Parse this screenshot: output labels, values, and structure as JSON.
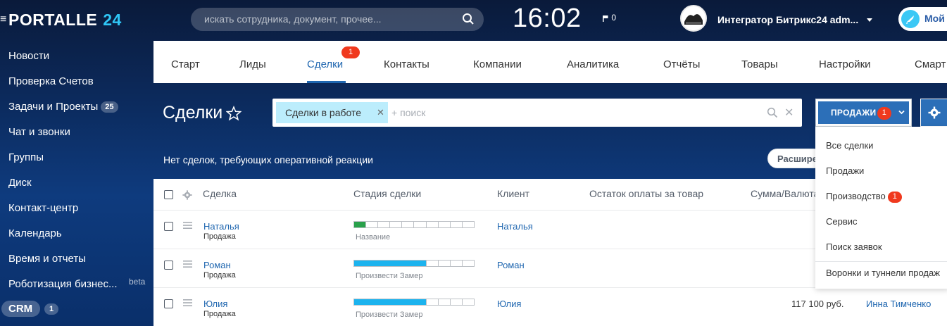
{
  "header": {
    "logo_text": "PORTALLE",
    "logo_number": "24",
    "search_placeholder": "искать сотрудника, документ, прочее...",
    "clock": "16:02",
    "flag_count": "0",
    "user_name": "Интегратор Битрикс24 adm...",
    "my_button_label": "Мой"
  },
  "sidebar": {
    "items": [
      {
        "label": "Новости"
      },
      {
        "label": "Проверка Счетов"
      },
      {
        "label": "Задачи и Проекты",
        "count": "25"
      },
      {
        "label": "Чат и звонки"
      },
      {
        "label": "Группы"
      },
      {
        "label": "Диск"
      },
      {
        "label": "Контакт-центр"
      },
      {
        "label": "Календарь"
      },
      {
        "label": "Время и отчеты"
      },
      {
        "label": "Роботизация бизнес..."
      }
    ],
    "beta_label": "beta",
    "crm_label": "CRM",
    "crm_count": "1"
  },
  "tabs": {
    "items": [
      "Старт",
      "Лиды",
      "Сделки",
      "Контакты",
      "Компании",
      "Аналитика",
      "Отчёты",
      "Товары",
      "Настройки",
      "Смарт"
    ],
    "active": "Сделки",
    "badge": "1"
  },
  "toolbar": {
    "title": "Сделки",
    "filter_chip": "Сделки в работе",
    "filter_placeholder": "+ поиск",
    "sales_button": "ПРОДАЖИ",
    "sales_badge": "1"
  },
  "notice": {
    "text": "Нет сделок, требующих оперативной реакции",
    "expand_button": "Расширенный"
  },
  "grid": {
    "columns": [
      "Сделка",
      "Стадия сделки",
      "Клиент",
      "Остаток оплаты за товар",
      "Сумма/Валюта"
    ],
    "rows": [
      {
        "name": "Наталья",
        "type": "Продажа",
        "stage": "Название",
        "stage_progress": 0.14,
        "stage_color": "#2aa14b",
        "client": "Наталья",
        "sum": "",
        "responsible": ""
      },
      {
        "name": "Роман",
        "type": "Продажа",
        "stage": "Произвести Замер",
        "stage_progress": 0.57,
        "stage_color": "#1cb3ee",
        "client": "Роман",
        "sum": "",
        "responsible": ""
      },
      {
        "name": "Юлия",
        "type": "Продажа",
        "stage": "Произвести Замер",
        "stage_progress": 0.57,
        "stage_color": "#1cb3ee",
        "client": "Юлия",
        "sum": "117 100 руб.",
        "responsible": "Инна Тимченко"
      }
    ]
  },
  "dropdown": {
    "items": [
      {
        "label": "Все сделки"
      },
      {
        "label": "Продажи"
      },
      {
        "label": "Производство",
        "badge": "1"
      },
      {
        "label": "Сервис"
      },
      {
        "label": "Поиск заявок"
      },
      {
        "label": "Воронки и туннели продаж"
      }
    ]
  }
}
